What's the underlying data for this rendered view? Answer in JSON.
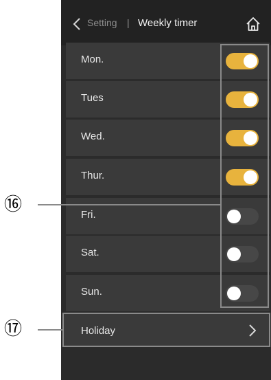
{
  "header": {
    "breadcrumb": "Setting",
    "separator": "|",
    "title": "Weekly timer",
    "back_icon": "chevron-left-icon",
    "home_icon": "home-icon"
  },
  "days": [
    {
      "label": "Mon.",
      "on": true
    },
    {
      "label": "Tues",
      "on": true
    },
    {
      "label": "Wed.",
      "on": true
    },
    {
      "label": "Thur.",
      "on": true
    },
    {
      "label": "Fri.",
      "on": false
    },
    {
      "label": "Sat.",
      "on": false
    },
    {
      "label": "Sun.",
      "on": false
    }
  ],
  "holiday": {
    "label": "Holiday"
  },
  "callouts": {
    "toggles": "⑯",
    "holiday": "⑰"
  },
  "colors": {
    "toggle_on": "#e8b33d",
    "toggle_off": "#474747",
    "background": "#2b2b2b"
  }
}
